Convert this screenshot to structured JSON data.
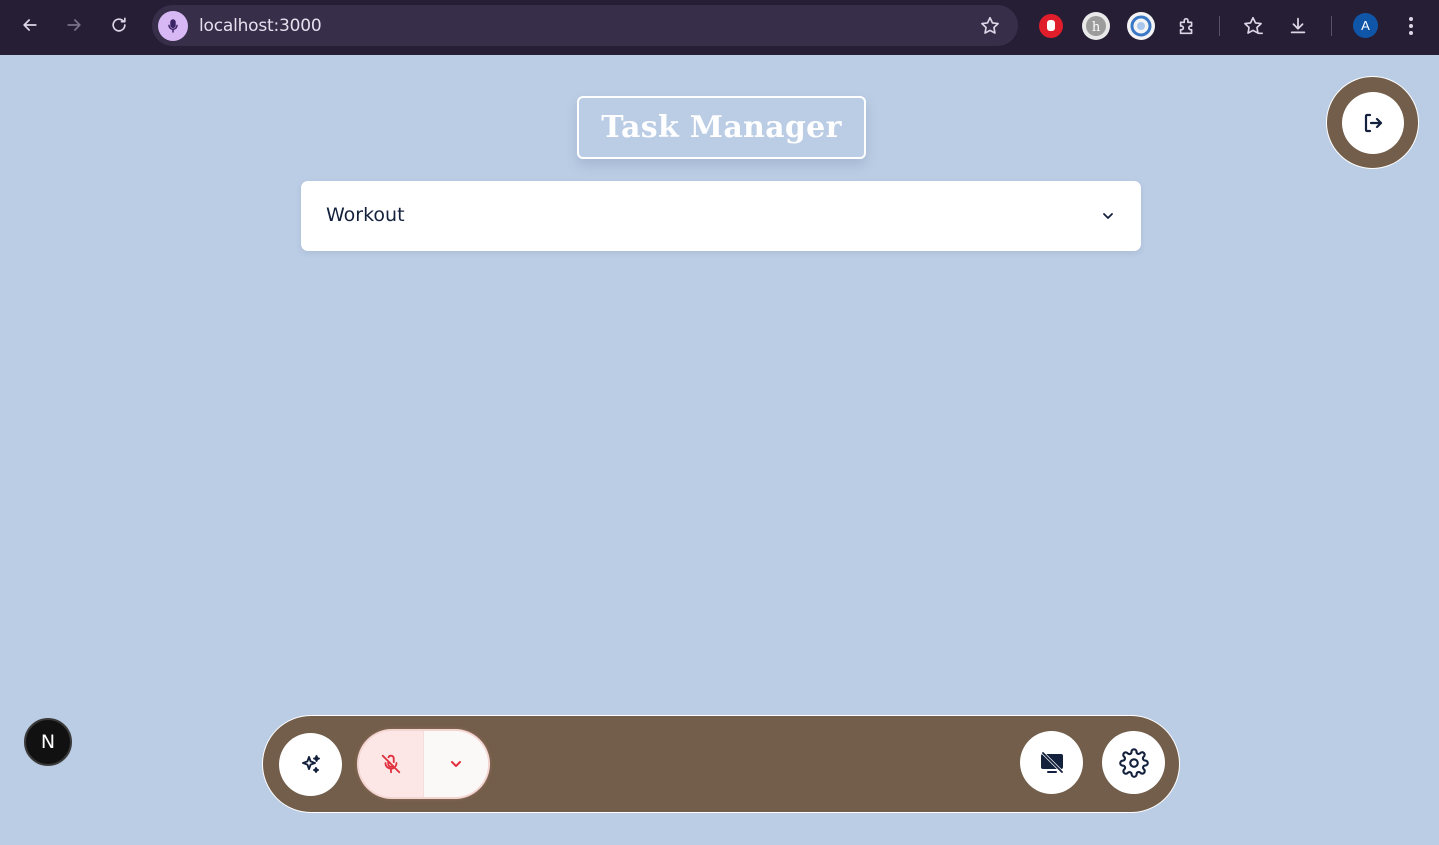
{
  "browser": {
    "url": "localhost:3000",
    "profile_initial": "A",
    "icons": [
      "back-icon",
      "forward-icon",
      "reload-icon",
      "mic-icon",
      "bookmark-star-icon",
      "extension-hand-icon",
      "extension-h-icon",
      "extension-circle-icon",
      "puzzle-icon",
      "bookmarks-icon",
      "download-icon",
      "kebab-menu-icon"
    ]
  },
  "page": {
    "title": "Task Manager",
    "selected_list": "Workout",
    "dev_badge": "N"
  },
  "colors": {
    "page_bg": "#bbcde5",
    "toolbar_bg": "#725e4a",
    "mic_muted": "#e0303e",
    "chrome_bg": "#261e35"
  },
  "toolbar": {
    "icons": [
      "sparkle-icon",
      "mic-off-icon",
      "chevron-down-icon",
      "screen-share-off-icon",
      "gear-icon"
    ]
  }
}
